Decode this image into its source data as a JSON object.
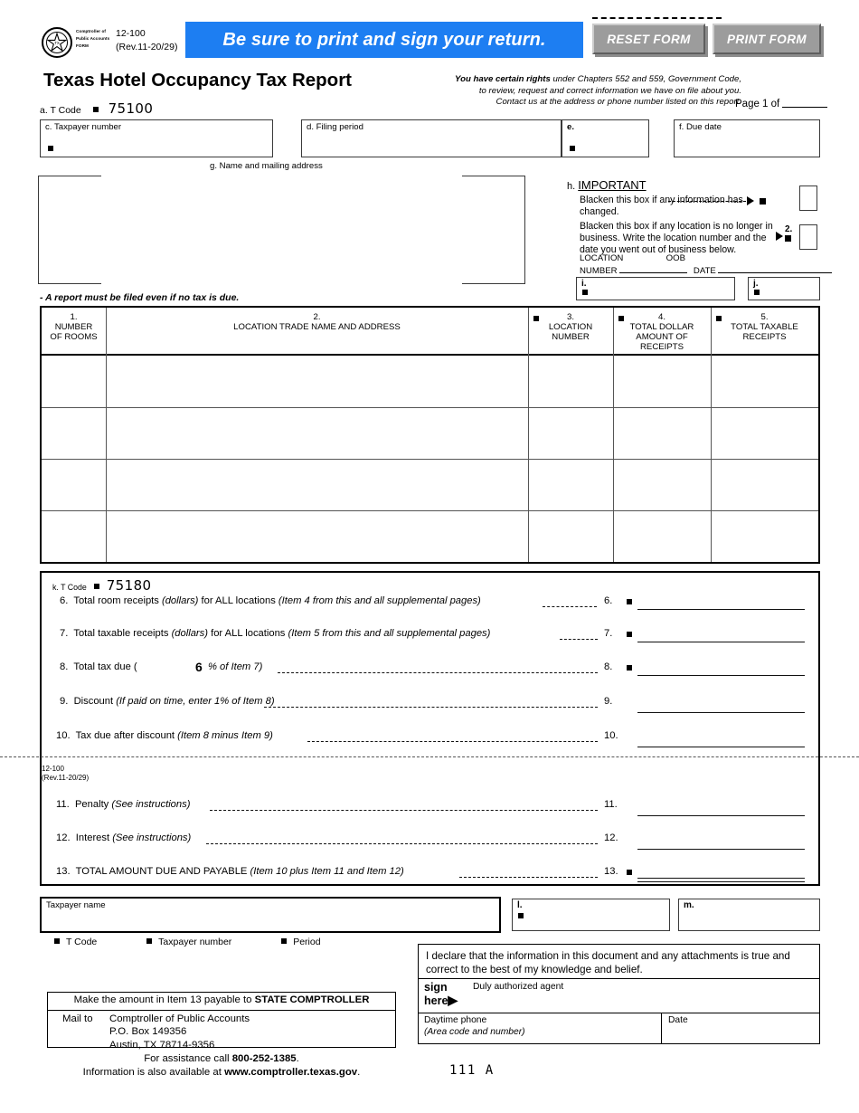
{
  "header": {
    "seal_words": "Comptroller of Public Accounts FORM",
    "form_number": "12-100",
    "revision": "(Rev.11-20/29)",
    "banner_text": "Be sure to print and sign your return.",
    "reset_button": "RESET FORM",
    "print_button": "PRINT  FORM",
    "title": "Texas Hotel Occupancy Tax Report",
    "rights_bold": "You have certain rights",
    "rights_line1": " under Chapters 552 and 559, Government Code,",
    "rights_line2": "to review, request and correct information we have on file about you.",
    "rights_line3": "Contact us at the address or phone number listed on this report.",
    "page_of": "Page 1 of",
    "t_code_label": "a. T Code",
    "t_code_value": "75100",
    "accent_blue": "#1d7ef2",
    "button_gray": "#9c9c9c"
  },
  "fields": {
    "c_label": "c. Taxpayer number",
    "d_label": "d. Filing period",
    "e_label": "e.",
    "f_label": "f. Due date",
    "g_label": "g. Name and mailing address"
  },
  "important": {
    "h_prefix": "h.",
    "title": "IMPORTANT",
    "note1": "Blacken this box if any information has changed.",
    "note2": "Blacken this box if any location is no longer in business. Write the location number and the date you went out of business below.",
    "marker2": "2.",
    "location_number_label1": "LOCATION",
    "location_number_label2": "NUMBER",
    "oob_label1": "OOB",
    "oob_label2": "DATE",
    "box_i_label": "i.",
    "box_j_label": "j."
  },
  "notice": "- A report must be filed even if no tax is due.",
  "table": {
    "columns": [
      {
        "num": "1.",
        "line1": "NUMBER",
        "line2": "OF ROOMS",
        "line3": "",
        "line4": ""
      },
      {
        "num": "2.",
        "line1": "LOCATION TRADE NAME AND ADDRESS",
        "line2": "",
        "line3": "",
        "line4": ""
      },
      {
        "num": "3.",
        "line1": "LOCATION",
        "line2": "NUMBER",
        "line3": "",
        "line4": ""
      },
      {
        "num": "4.",
        "line1": "TOTAL DOLLAR",
        "line2": "AMOUNT OF",
        "line3": "RECEIPTS",
        "line4": ""
      },
      {
        "num": "5.",
        "line1": "TOTAL TAXABLE",
        "line2": "RECEIPTS",
        "line3": "",
        "line4": ""
      }
    ],
    "rows": [
      {
        "rooms": "",
        "location": "",
        "location_number": "",
        "total_dollar": "",
        "total_taxable": ""
      },
      {
        "rooms": "",
        "location": "",
        "location_number": "",
        "total_dollar": "",
        "total_taxable": ""
      },
      {
        "rooms": "",
        "location": "",
        "location_number": "",
        "total_dollar": "",
        "total_taxable": ""
      },
      {
        "rooms": "",
        "location": "",
        "location_number": "",
        "total_dollar": "",
        "total_taxable": ""
      }
    ]
  },
  "summary": {
    "t_code_label": "k. T Code",
    "t_code_value": "75180",
    "items": [
      {
        "no": "6.",
        "text": "Total room receipts ",
        "italic1": "(dollars)",
        "text2": " for ALL locations ",
        "italic2": "(Item 4 from this and all supplemental pages)",
        "right_no": "6.",
        "value": ""
      },
      {
        "no": "7.",
        "text": "Total taxable receipts ",
        "italic1": "(dollars)",
        "text2": " for ALL locations ",
        "italic2": "(Item 5 from this and all supplemental pages)",
        "right_no": "7.",
        "value": ""
      },
      {
        "no": "8.",
        "text": "Total tax due (",
        "rate": "6",
        "italic2": "% of Item 7)",
        "right_no": "8.",
        "value": ""
      },
      {
        "no": "9.",
        "text": "Discount ",
        "italic2": "(If paid on time, enter 1% of Item 8)",
        "right_no": "9.",
        "value": ""
      },
      {
        "no": "10.",
        "text": "Tax due after discount ",
        "italic2": "(Item 8 minus Item 9)",
        "right_no": "10.",
        "value": ""
      },
      {
        "no": "11.",
        "text": "Penalty ",
        "italic2": "(See instructions)",
        "right_no": "11.",
        "value": ""
      },
      {
        "no": "12.",
        "text": "Interest ",
        "italic2": "(See instructions)",
        "right_no": "12.",
        "value": ""
      },
      {
        "no": "13.",
        "text": "TOTAL AMOUNT DUE AND PAYABLE ",
        "italic2": "(Item 10 plus Item 11 and Item 12)",
        "right_no": "13.",
        "value": ""
      }
    ],
    "rev_form_number": "12-100",
    "rev_revision": "(Rev.11-20/29)"
  },
  "bottom": {
    "taxpayer_name_label": "Taxpayer name",
    "l_label": "l.",
    "m_label": "m.",
    "legend": [
      "T Code",
      "Taxpayer number",
      "Period"
    ],
    "declaration": "I declare that the information in this document and any attachments is true and correct to the best of my knowledge and belief.",
    "sign_here_1": "sign",
    "sign_here_2": "here",
    "duly_authorized": "Duly authorized agent",
    "daytime_phone_1": "Daytime phone",
    "daytime_phone_2": "(Area code and number)",
    "date_label": "Date",
    "payable_prefix": "Make the amount in Item 13 payable to ",
    "payable_to": "STATE COMPTROLLER",
    "mail_to_label": "Mail to",
    "mail_line1": "Comptroller of Public Accounts",
    "mail_line2": "P.O. Box 149356",
    "mail_line3": "Austin, TX  78714-9356",
    "assist_prefix": "For assistance call ",
    "assist_phone": "800-252-1385",
    "assist_suffix": ".",
    "info_prefix": "Information is also available at ",
    "info_url": "www.comptroller.texas.gov",
    "info_suffix": ".",
    "ocr_mark": "111 A"
  }
}
